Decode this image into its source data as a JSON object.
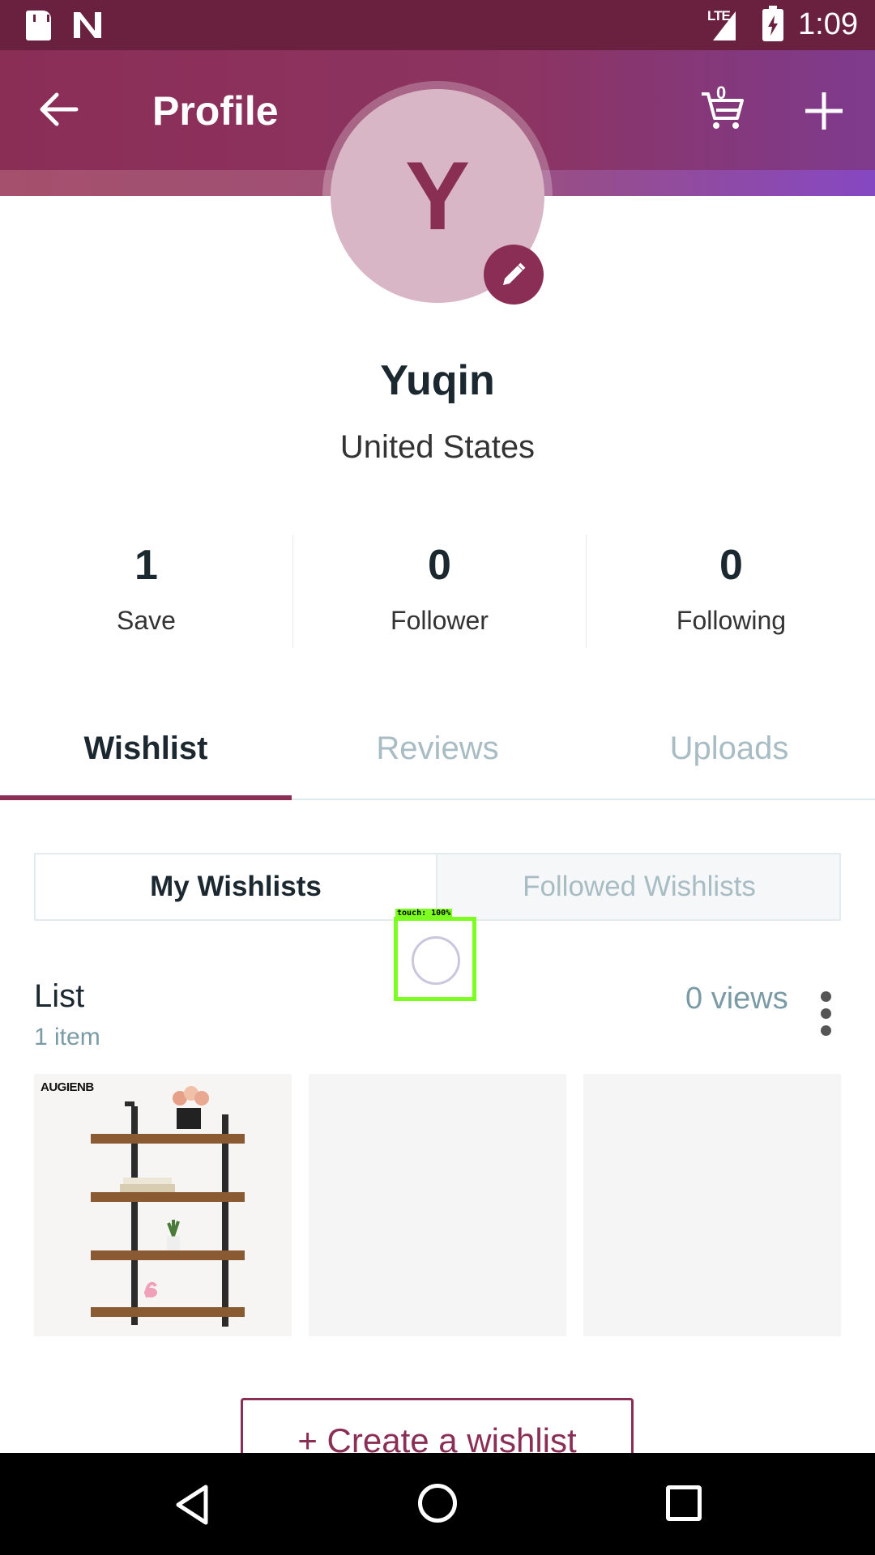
{
  "status_bar": {
    "time": "1:09",
    "network": "LTE"
  },
  "header": {
    "title": "Profile",
    "cart_count": "0"
  },
  "profile": {
    "avatar_letter": "Y",
    "name": "Yuqin",
    "location": "United States"
  },
  "stats": [
    {
      "value": "1",
      "label": "Save"
    },
    {
      "value": "0",
      "label": "Follower"
    },
    {
      "value": "0",
      "label": "Following"
    }
  ],
  "tabs": [
    {
      "label": "Wishlist",
      "active": true
    },
    {
      "label": "Reviews",
      "active": false
    },
    {
      "label": "Uploads",
      "active": false
    }
  ],
  "segments": {
    "left": "My Wishlists",
    "right": "Followed Wishlists"
  },
  "touch_overlay": {
    "label": "touch: 100%"
  },
  "list": {
    "title": "List",
    "count": "1 item",
    "views": "0 views",
    "brand": "AUGIENB"
  },
  "create_button": {
    "label": "+ Create a wishlist"
  },
  "colors": {
    "brand": "#8b2e56",
    "status_bar": "#6a2140",
    "muted": "#a8bcc4"
  }
}
